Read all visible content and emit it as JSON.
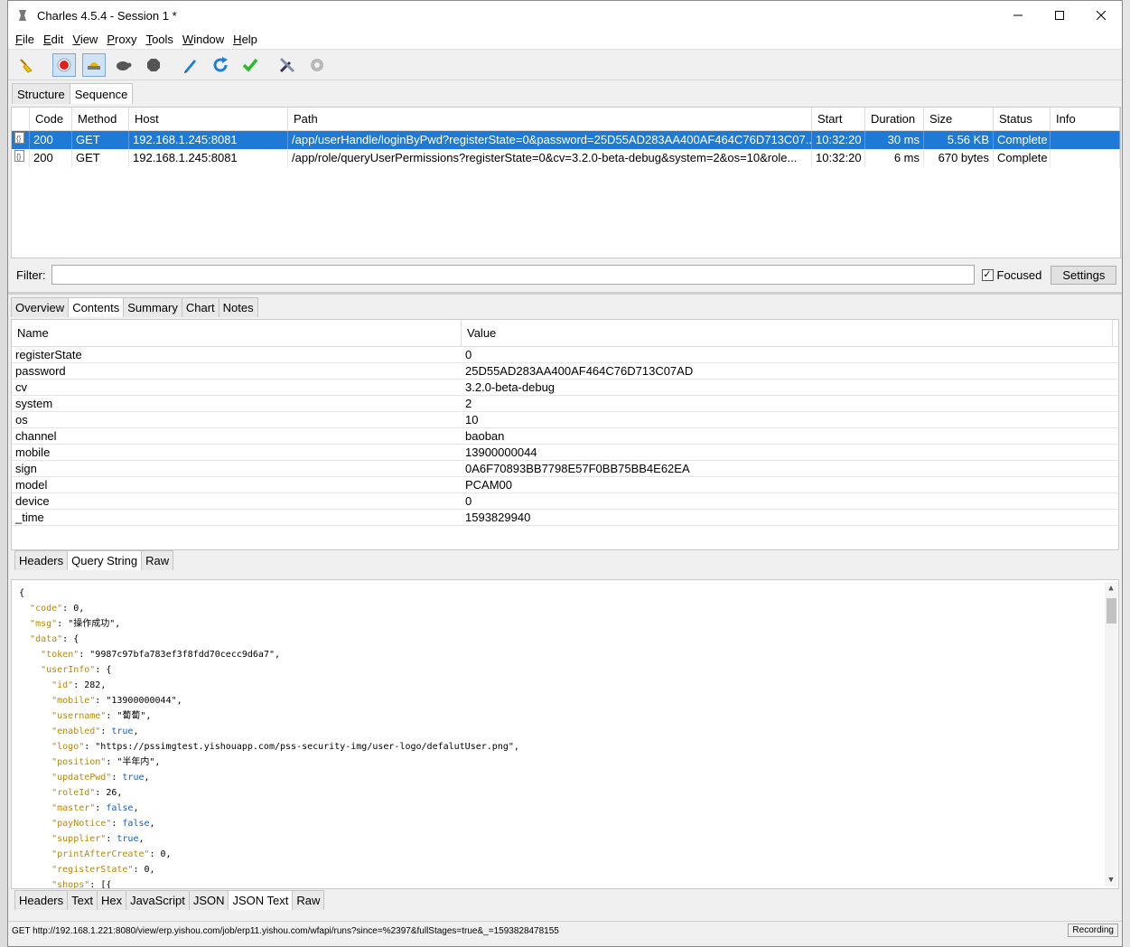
{
  "window": {
    "title": "Charles 4.5.4 - Session 1 *"
  },
  "menu": [
    "File",
    "Edit",
    "View",
    "Proxy",
    "Tools",
    "Window",
    "Help"
  ],
  "menu_mnemonic": [
    "F",
    "E",
    "V",
    "P",
    "T",
    "W",
    "H"
  ],
  "top_tabs": [
    "Structure",
    "Sequence"
  ],
  "sequence": {
    "columns": [
      "Code",
      "Method",
      "Host",
      "Path",
      "Start",
      "Duration",
      "Size",
      "Status",
      "Info"
    ],
    "rows": [
      {
        "code": "200",
        "method": "GET",
        "host": "192.168.1.245:8081",
        "path": "/app/userHandle/loginByPwd?registerState=0&password=25D55AD283AA400AF464C76D713C07...",
        "start": "10:32:20",
        "duration": "30 ms",
        "size": "5.56 KB",
        "status": "Complete",
        "info": ""
      },
      {
        "code": "200",
        "method": "GET",
        "host": "192.168.1.245:8081",
        "path": "/app/role/queryUserPermissions?registerState=0&cv=3.2.0-beta-debug&system=2&os=10&role...",
        "start": "10:32:20",
        "duration": "6 ms",
        "size": "670 bytes",
        "status": "Complete",
        "info": ""
      }
    ]
  },
  "filter": {
    "label": "Filter:",
    "value": "",
    "focused_label": "Focused",
    "settings_label": "Settings"
  },
  "detail_tabs": [
    "Overview",
    "Contents",
    "Summary",
    "Chart",
    "Notes"
  ],
  "query": {
    "columns": [
      "Name",
      "Value"
    ],
    "rows": [
      [
        "registerState",
        "0"
      ],
      [
        "password",
        "25D55AD283AA400AF464C76D713C07AD"
      ],
      [
        "cv",
        "3.2.0-beta-debug"
      ],
      [
        "system",
        "2"
      ],
      [
        "os",
        "10"
      ],
      [
        "channel",
        "baoban"
      ],
      [
        "mobile",
        "13900000044"
      ],
      [
        "sign",
        "0A6F70893BB7798E57F0BB75BB4E62EA"
      ],
      [
        "model",
        "PCAM00"
      ],
      [
        "device",
        "0"
      ],
      [
        "_time",
        "1593829940"
      ]
    ]
  },
  "request_tabs": [
    "Headers",
    "Query String",
    "Raw"
  ],
  "json_lines": [
    "{",
    "  \"code\": 0,",
    "  \"msg\": \"操作成功\",",
    "  \"data\": {",
    "    \"token\": \"9987c97bfa783ef3f8fdd70cecc9d6a7\",",
    "    \"userInfo\": {",
    "      \"id\": 282,",
    "      \"mobile\": \"13900000044\",",
    "      \"username\": \"蔔蔔\",",
    "      \"enabled\": true,",
    "      \"logo\": \"https://pssimgtest.yishouapp.com/pss-security-img/user-logo/defalutUser.png\",",
    "      \"position\": \"半年内\",",
    "      \"updatePwd\": true,",
    "      \"roleId\": 26,",
    "      \"master\": false,",
    "      \"payNotice\": false,",
    "      \"supplier\": true,",
    "      \"printAfterCreate\": 0,",
    "      \"registerState\": 0,",
    "      \"shops\": [{"
  ],
  "response_tabs": [
    "Headers",
    "Text",
    "Hex",
    "JavaScript",
    "JSON",
    "JSON Text",
    "Raw"
  ],
  "status": {
    "text": "GET http://192.168.1.221:8080/view/erp.yishou.com/job/erp11.yishou.com/wfapi/runs?since=%2397&fullStages=true&_=1593828478155",
    "recording": "Recording"
  },
  "colors": {
    "selection": "#1f7ad6",
    "record": "#e02020",
    "check": "#2db82d",
    "refresh": "#1e7fd8"
  },
  "icons": [
    "broom-icon",
    "record-icon",
    "throttle-icon",
    "turtle-icon",
    "stop-icon",
    "pen-icon",
    "refresh-icon",
    "check-icon",
    "tools-icon",
    "gear-icon"
  ]
}
